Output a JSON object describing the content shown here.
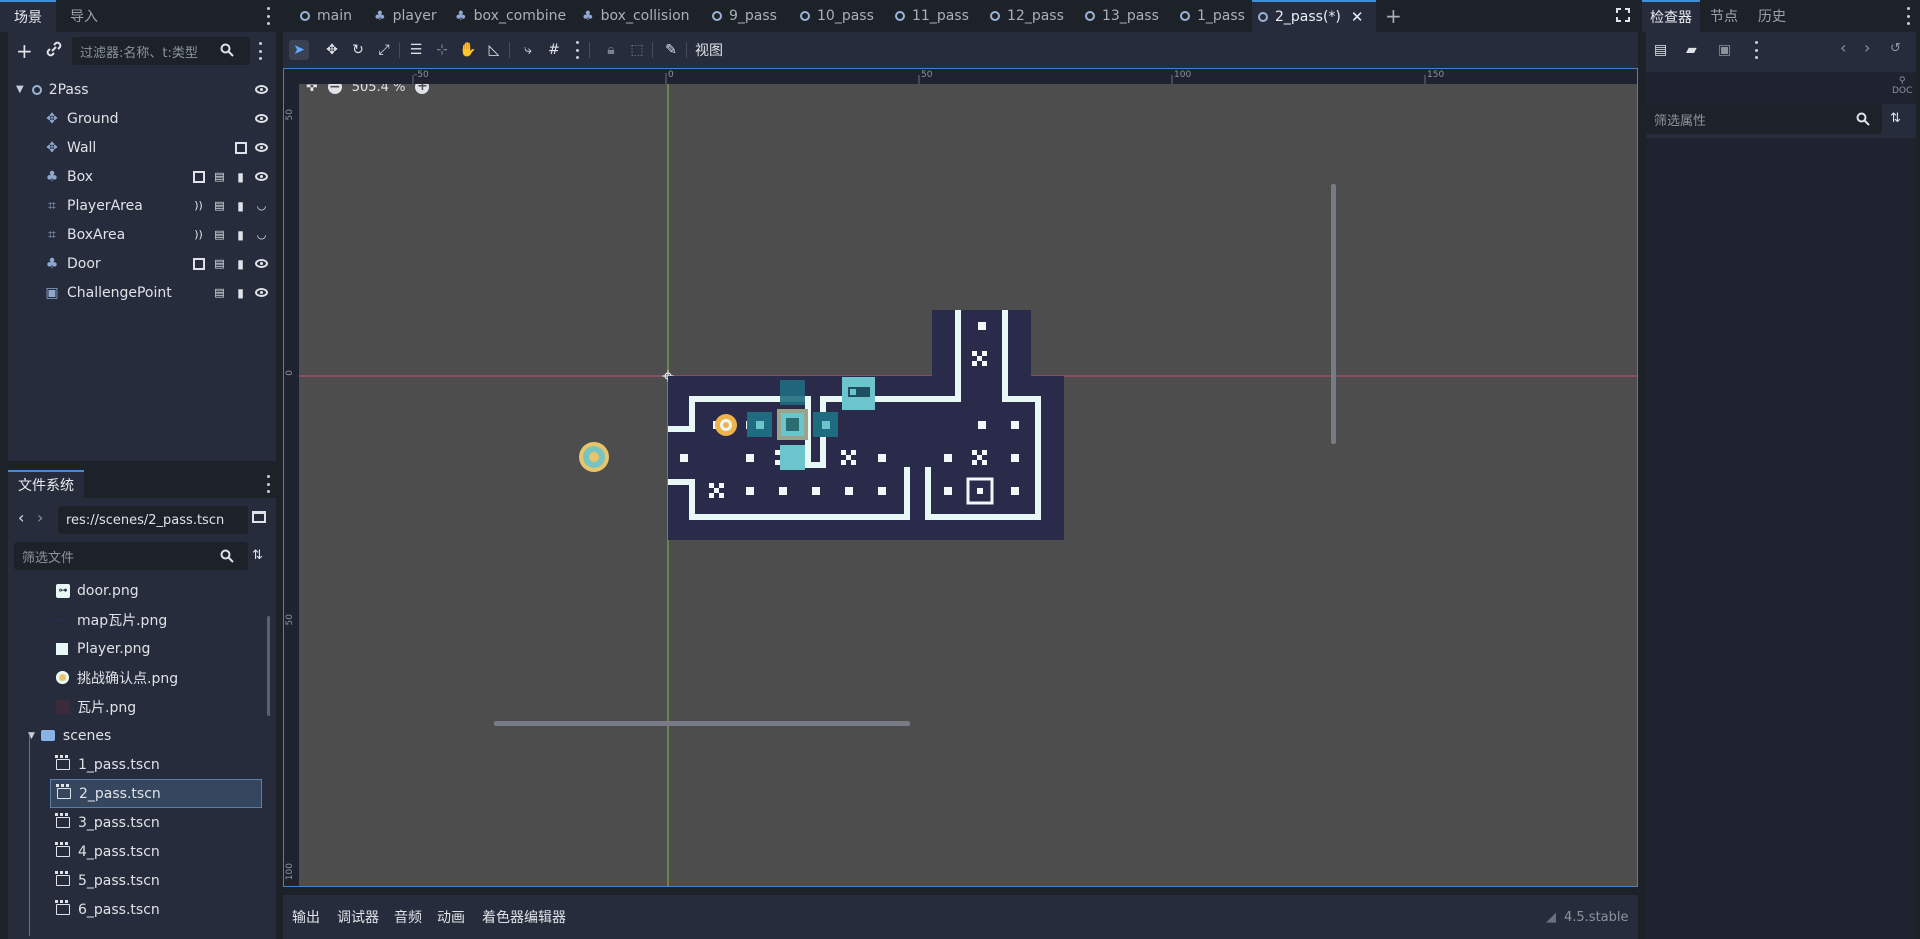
{
  "left_dock": {
    "tabs": [
      "场景",
      "导入"
    ],
    "filter_placeholder": "过滤器:名称、t:类型",
    "tree": [
      {
        "label": "2Pass",
        "icon": "node-ring-icon"
      },
      {
        "label": "Ground",
        "icon": "tilemap-icon"
      },
      {
        "label": "Wall",
        "icon": "tilemap-icon"
      },
      {
        "label": "Box",
        "icon": "characterbody-icon"
      },
      {
        "label": "PlayerArea",
        "icon": "area-icon"
      },
      {
        "label": "BoxArea",
        "icon": "area-icon"
      },
      {
        "label": "Door",
        "icon": "characterbody-icon"
      },
      {
        "label": "ChallengePoint",
        "icon": "animated-sprite-icon"
      }
    ]
  },
  "filesystem": {
    "tab": "文件系统",
    "path": "res://scenes/2_pass.tscn",
    "filter_placeholder": "筛选文件",
    "files": [
      {
        "label": "door.png",
        "kind": "image"
      },
      {
        "label": "map瓦片.png",
        "kind": "image"
      },
      {
        "label": "Player.png",
        "kind": "image"
      },
      {
        "label": "挑战确认点.png",
        "kind": "image"
      },
      {
        "label": "瓦片.png",
        "kind": "image"
      },
      {
        "label": "scenes",
        "kind": "folder"
      },
      {
        "label": "1_pass.tscn",
        "kind": "scene"
      },
      {
        "label": "2_pass.tscn",
        "kind": "scene",
        "selected": true
      },
      {
        "label": "3_pass.tscn",
        "kind": "scene"
      },
      {
        "label": "4_pass.tscn",
        "kind": "scene"
      },
      {
        "label": "5_pass.tscn",
        "kind": "scene"
      },
      {
        "label": "6_pass.tscn",
        "kind": "scene"
      }
    ]
  },
  "scene_tabs": [
    {
      "label": "main",
      "icon": "ring"
    },
    {
      "label": "player",
      "icon": "tool"
    },
    {
      "label": "box_combine",
      "icon": "tool"
    },
    {
      "label": "box_collision",
      "icon": "tool"
    },
    {
      "label": "9_pass",
      "icon": "ring"
    },
    {
      "label": "10_pass",
      "icon": "ring"
    },
    {
      "label": "11_pass",
      "icon": "ring"
    },
    {
      "label": "12_pass",
      "icon": "ring"
    },
    {
      "label": "13_pass",
      "icon": "ring"
    },
    {
      "label": "1_pass",
      "icon": "ring"
    },
    {
      "label": "2_pass(*)",
      "icon": "ring",
      "active": true
    }
  ],
  "toolbar": {
    "view_label": "视图"
  },
  "viewport": {
    "zoom": "505.4 %",
    "ruler_top": [
      "-50",
      "0",
      "50",
      "100",
      "150"
    ],
    "ruler_left": [
      "50",
      "0",
      "50",
      "100"
    ]
  },
  "bottom_panel": {
    "tabs": [
      "输出",
      "调试器",
      "音频",
      "动画",
      "着色器编辑器"
    ],
    "version": "4.5.stable"
  },
  "right_dock": {
    "tabs": [
      "检查器",
      "节点",
      "历史"
    ],
    "filter_placeholder": "筛选属性"
  },
  "colors": {
    "accent": "#3d8fd9",
    "level_floor": "#2a2a4a",
    "level_wall": "#e8f8f6",
    "box_teal": "#6cc4cc"
  }
}
